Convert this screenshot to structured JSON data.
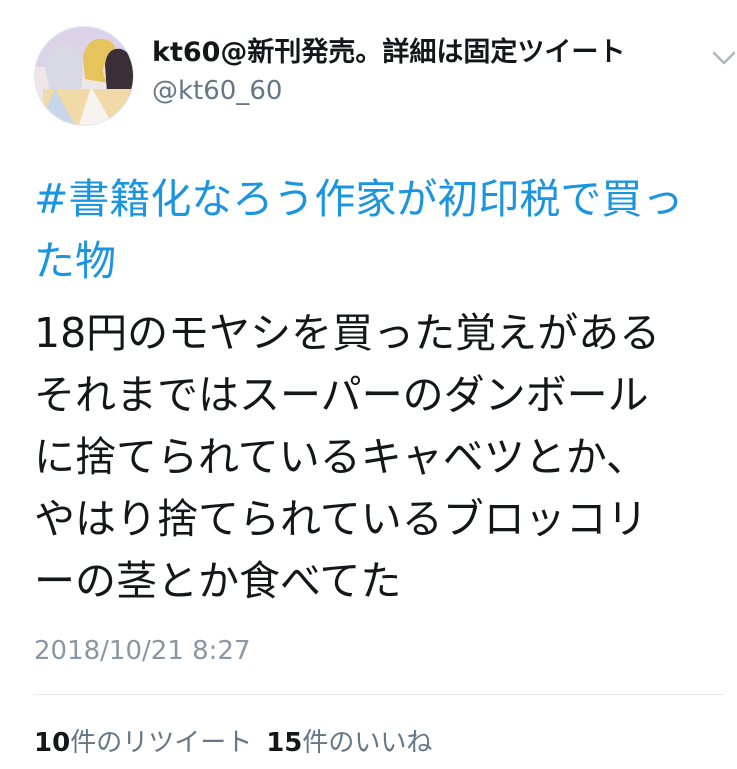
{
  "tweet": {
    "author": {
      "display_name": "kt60@新刊発売。詳細は固定ツイート",
      "handle": "@kt60_60"
    },
    "hashtag": "#書籍化なろう作家が初印税で買った物",
    "body": "18円のモヤシを買った覚えがある\nそれまではスーパーのダンボール\nに捨てられているキャベツとか、\nやはり捨てられているブロッコリ\nーの茎とか食べてた",
    "timestamp": "2018/10/21 8:27",
    "stats": {
      "retweets_count": "10",
      "retweets_label": "件のリツイート",
      "likes_count": "15",
      "likes_label": "件のいいね"
    }
  },
  "colors": {
    "link": "#1b95e0",
    "text": "#14171a",
    "muted": "#657786",
    "divider": "#e1e8ed"
  },
  "icons": {
    "menu": "chevron-down-icon"
  }
}
